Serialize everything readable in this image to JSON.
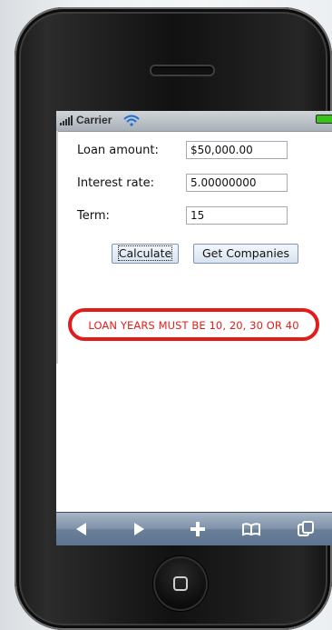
{
  "status_bar": {
    "carrier": "Carrier",
    "battery_color": "#38c21c"
  },
  "form": {
    "loan_amount_label": "Loan amount:",
    "loan_amount_value": "$50,000.00",
    "interest_rate_label": "Interest rate:",
    "interest_rate_value": "5.00000000",
    "term_label": "Term:",
    "term_value": "15"
  },
  "buttons": {
    "calculate_label": "Calculate",
    "companies_label": "Get Companies"
  },
  "error": {
    "message": "LOAN YEARS MUST BE 10, 20, 30 OR 40",
    "color": "#e1201a"
  },
  "toolbar": {
    "icons": [
      "back-icon",
      "forward-icon",
      "add-icon",
      "bookmarks-icon",
      "pages-icon"
    ]
  }
}
